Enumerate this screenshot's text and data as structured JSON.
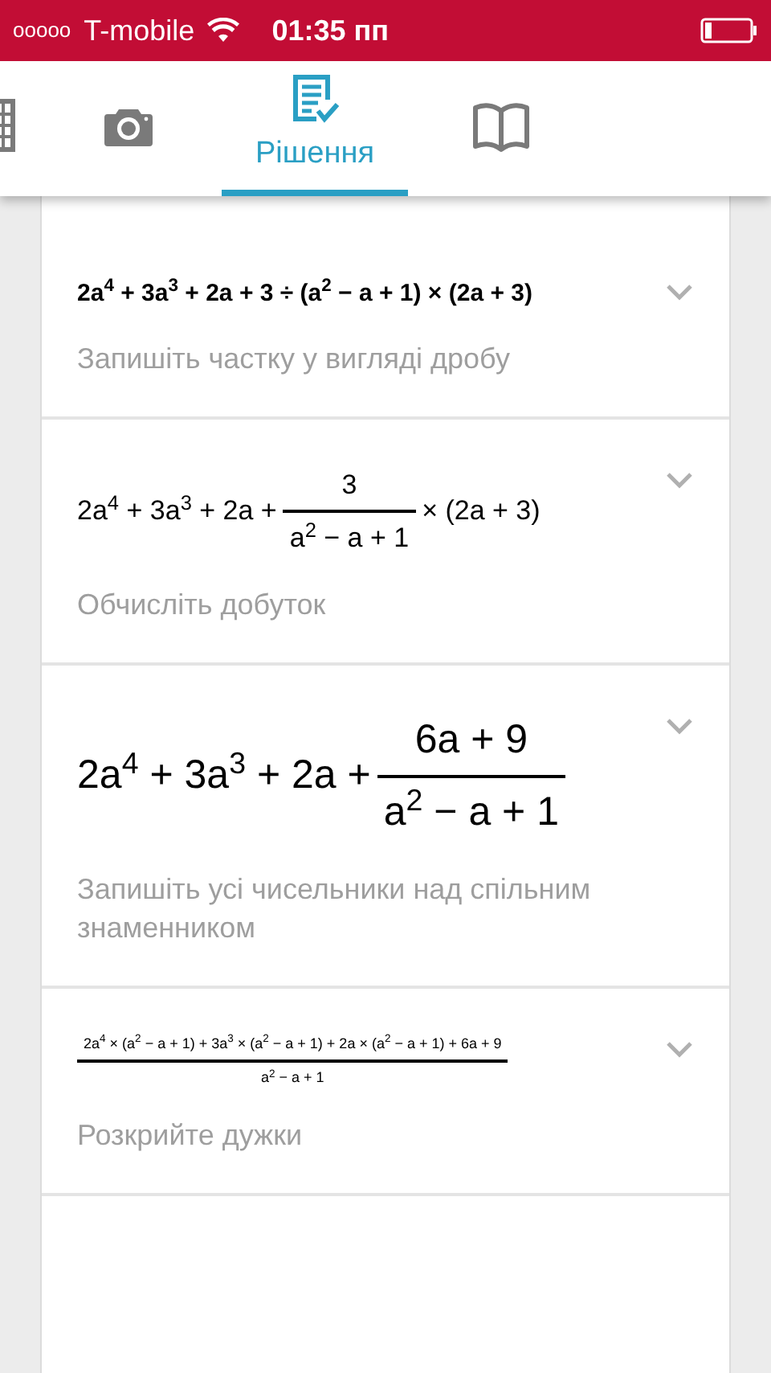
{
  "status_bar": {
    "signal": "ooooo",
    "carrier": "T-mobile",
    "time": "01:35 пп"
  },
  "tabs": [
    {
      "kind": "table",
      "selected": false
    },
    {
      "kind": "camera",
      "selected": false
    },
    {
      "kind": "solution",
      "label": "Рішення",
      "selected": true
    },
    {
      "kind": "book",
      "selected": false
    }
  ],
  "steps": [
    {
      "expression": [
        {
          "kind": "text",
          "text": "2a$^{4}$ + 3a$^{3}$ + 2a + 3 ÷ (a$^{2}$ − a + 1) × (2a + 3)"
        }
      ],
      "hint": "Запишіть частку у вигляді дробу"
    },
    {
      "expression": [
        {
          "kind": "text",
          "text": "2a$^{4}$ + 3a$^{3}$ + 2a +"
        },
        {
          "kind": "fraction",
          "numerator": "3",
          "denominator": "a$^{2}$ − a + 1"
        },
        {
          "kind": "text",
          "text": "× (2a + 3)"
        }
      ],
      "hint": "Обчисліть добуток"
    },
    {
      "expression": [
        {
          "kind": "text",
          "text": "2a$^{4}$ + 3a$^{3}$ + 2a +"
        },
        {
          "kind": "fraction",
          "numerator": "6a + 9",
          "denominator": "a$^{2}$ − a + 1"
        }
      ],
      "hint": "Запишіть усі чисельники над спільним знаменником"
    },
    {
      "expression": [
        {
          "kind": "fraction",
          "numerator": "2a$^{4}$ × (a$^{2}$ − a + 1) + 3a$^{3}$ × (a$^{2}$ − a + 1) + 2a × (a$^{2}$ − a + 1) + 6a + 9",
          "denominator": "a$^{2}$ − a + 1"
        }
      ],
      "hint": "Розкрийте дужки"
    }
  ]
}
